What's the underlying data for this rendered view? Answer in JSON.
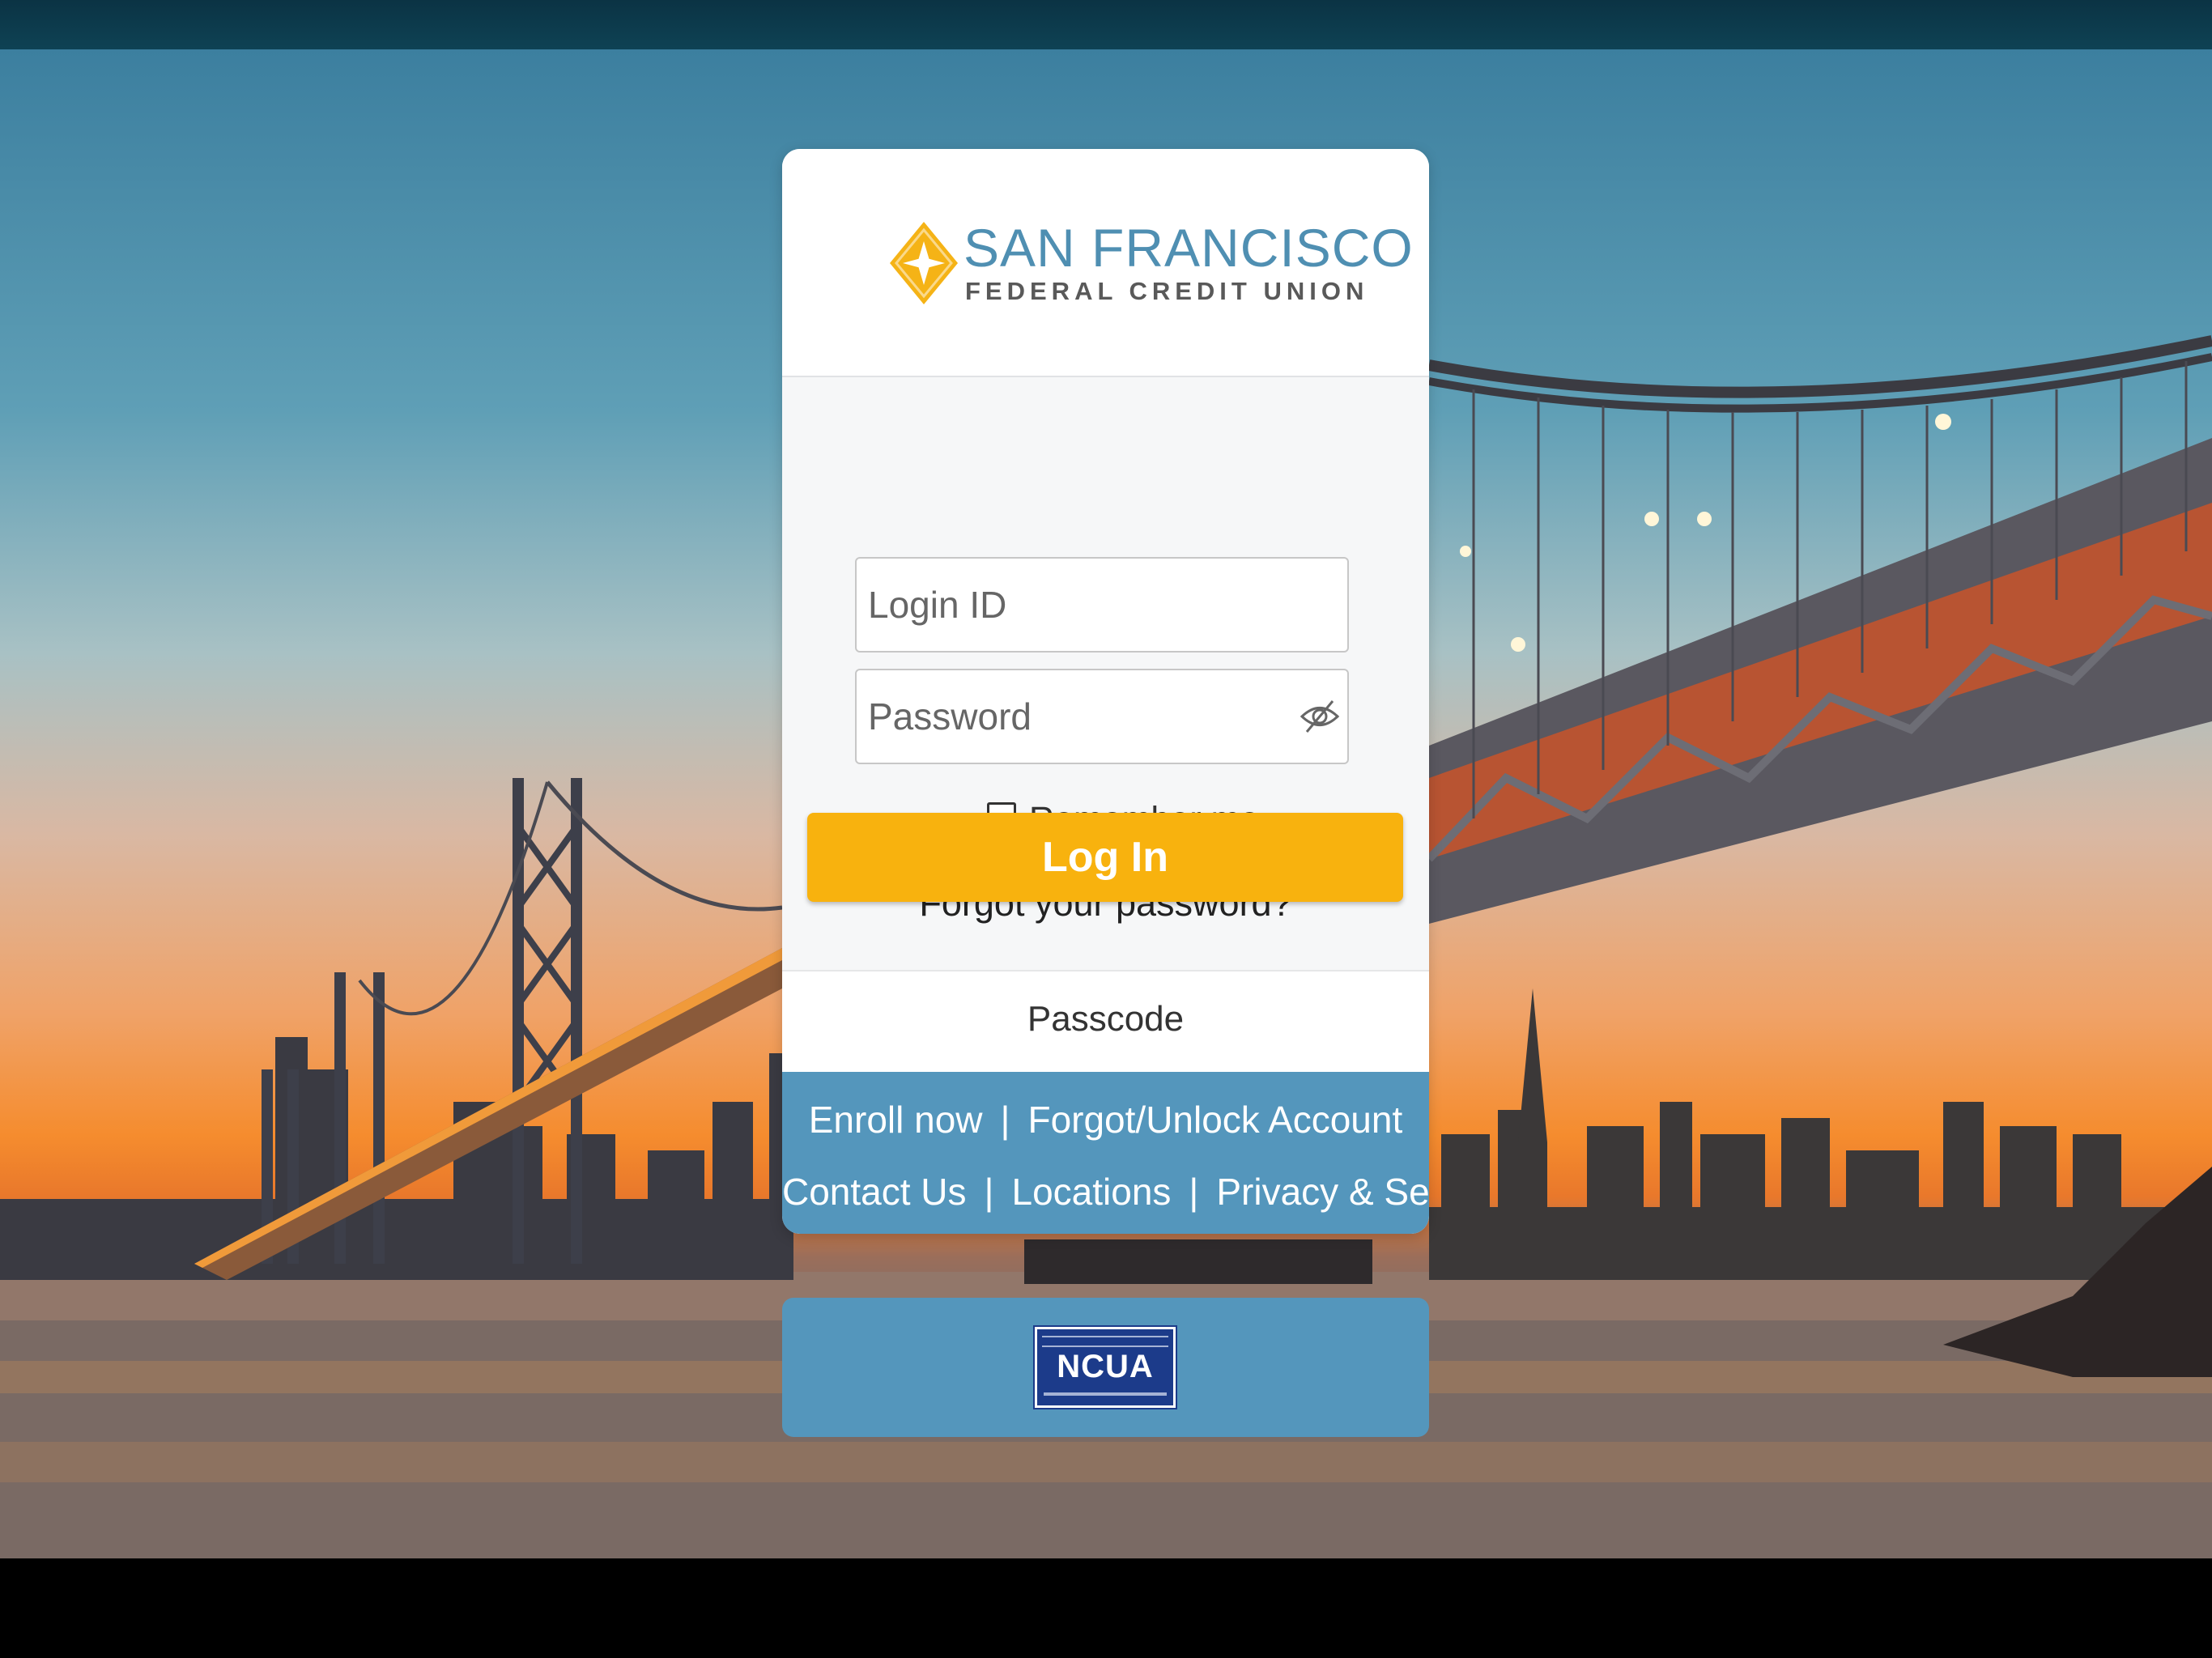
{
  "brand": {
    "name": "SAN FRANCISCO",
    "tagline": "FEDERAL CREDIT UNION",
    "logo_icon": "compass-star-icon",
    "colors": {
      "brand_blue": "#4f8fb2",
      "brand_gold": "#f8b20e",
      "footer_blue": "#5496bc"
    }
  },
  "login_form": {
    "login_id_placeholder": "Login ID",
    "password_placeholder": "Password",
    "password_toggle_icon": "eye-slash-icon",
    "remember_me_label": "Remember me",
    "remember_me_checked": false,
    "forgot_password_link": "Forgot your password?",
    "login_button": "Log In"
  },
  "passcode": {
    "label": "Passcode"
  },
  "footer_links": {
    "enroll": "Enroll now",
    "forgot_unlock": "Forgot/Unlock Account",
    "contact": "Contact Us",
    "locations": "Locations",
    "privacy": "Privacy & Security",
    "separator": "|"
  },
  "ncua_badge": {
    "label": "NCUA"
  }
}
